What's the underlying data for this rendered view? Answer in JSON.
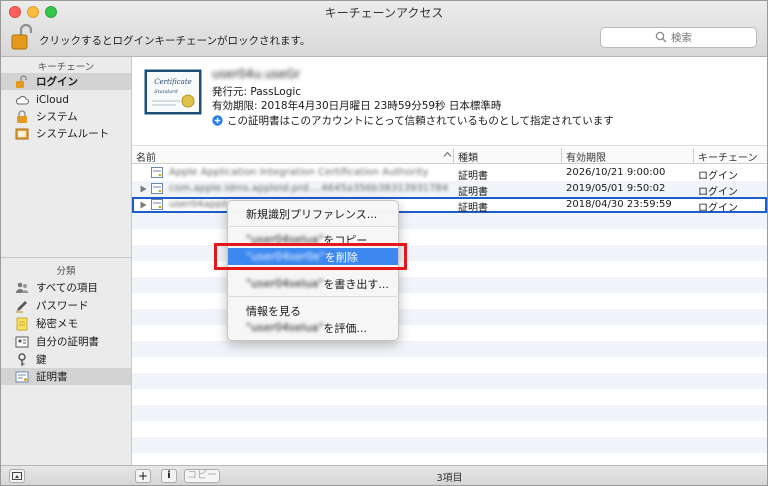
{
  "window": {
    "title": "キーチェーンアクセス"
  },
  "toolbar": {
    "lock_message": "クリックするとログインキーチェーンがロックされます。"
  },
  "search": {
    "placeholder": "検索"
  },
  "sidebar": {
    "keychains_header": "キーチェーン",
    "keychains": [
      {
        "label": "ログイン",
        "icon": "lock-open-icon",
        "selected": true
      },
      {
        "label": "iCloud",
        "icon": "cloud-icon",
        "selected": false
      },
      {
        "label": "システム",
        "icon": "lock-icon",
        "selected": false
      },
      {
        "label": "システムルート",
        "icon": "cabinet-icon",
        "selected": false
      }
    ],
    "categories_header": "分類",
    "categories": [
      {
        "label": "すべての項目",
        "icon": "people-icon",
        "selected": false
      },
      {
        "label": "パスワード",
        "icon": "pen-icon",
        "selected": false
      },
      {
        "label": "秘密メモ",
        "icon": "note-icon",
        "selected": false
      },
      {
        "label": "自分の証明書",
        "icon": "my-certificate-icon",
        "selected": false
      },
      {
        "label": "鍵",
        "icon": "key-icon",
        "selected": false
      },
      {
        "label": "証明書",
        "icon": "certificate-icon",
        "selected": true
      }
    ]
  },
  "certificate": {
    "name": "user04u.useGr",
    "issuer": "発行元: PassLogic",
    "expiry": "有効期限: 2018年4月30日月曜日 23時59分59秒 日本標準時",
    "trust": "この証明書はこのアカウントにとって信頼されているものとして指定されています",
    "image_line1": "Certificate",
    "image_line2": "Standard"
  },
  "table": {
    "columns": [
      "名前",
      "種類",
      "有効期限",
      "キーチェーン"
    ],
    "rows": [
      {
        "name": "Apple Application Integration Certification Authority",
        "kind": "証明書",
        "expires": "2026/10/21 9:00:00",
        "keychain": "ログイン",
        "expandable": false,
        "selected": false
      },
      {
        "name": "com.apple.idms.appleid.prd....4645a356b38313931784f3c3d",
        "kind": "証明書",
        "expires": "2019/05/01 9:50:02",
        "keychain": "ログイン",
        "expandable": true,
        "selected": false
      },
      {
        "name": "user04applica",
        "kind": "証明書",
        "expires": "2018/04/30 23:59:59",
        "keychain": "ログイン",
        "expandable": true,
        "selected": true
      }
    ]
  },
  "context_menu": {
    "new_identity_pref": "新規識別プリファレンス...",
    "copy_name": "\"user04selua\"",
    "copy_suffix": "をコピー",
    "delete_name": "\"user04ser0e\"",
    "delete_suffix": "を削除",
    "export_name": "\"user04selua\"",
    "export_suffix": "を書き出す...",
    "get_info": "情報を見る",
    "evaluate_name": "\"user04selua\"",
    "evaluate_suffix": "を評価..."
  },
  "bottom_bar": {
    "add": "+",
    "info": "i",
    "copy": "コピー",
    "item_count": "3項目"
  }
}
